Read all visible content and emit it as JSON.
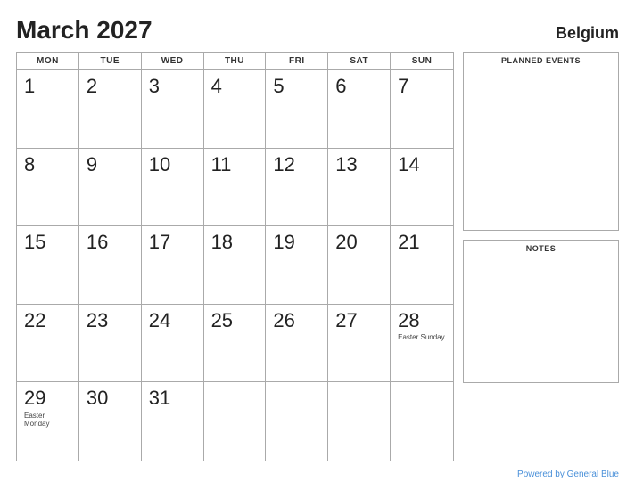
{
  "header": {
    "month_year": "March 2027",
    "country": "Belgium"
  },
  "days_of_week": [
    "MON",
    "TUE",
    "WED",
    "THU",
    "FRI",
    "SAT",
    "SUN"
  ],
  "weeks": [
    [
      {
        "num": "1",
        "event": ""
      },
      {
        "num": "2",
        "event": ""
      },
      {
        "num": "3",
        "event": ""
      },
      {
        "num": "4",
        "event": ""
      },
      {
        "num": "5",
        "event": ""
      },
      {
        "num": "6",
        "event": ""
      },
      {
        "num": "7",
        "event": ""
      }
    ],
    [
      {
        "num": "8",
        "event": ""
      },
      {
        "num": "9",
        "event": ""
      },
      {
        "num": "10",
        "event": ""
      },
      {
        "num": "11",
        "event": ""
      },
      {
        "num": "12",
        "event": ""
      },
      {
        "num": "13",
        "event": ""
      },
      {
        "num": "14",
        "event": ""
      }
    ],
    [
      {
        "num": "15",
        "event": ""
      },
      {
        "num": "16",
        "event": ""
      },
      {
        "num": "17",
        "event": ""
      },
      {
        "num": "18",
        "event": ""
      },
      {
        "num": "19",
        "event": ""
      },
      {
        "num": "20",
        "event": ""
      },
      {
        "num": "21",
        "event": ""
      }
    ],
    [
      {
        "num": "22",
        "event": ""
      },
      {
        "num": "23",
        "event": ""
      },
      {
        "num": "24",
        "event": ""
      },
      {
        "num": "25",
        "event": ""
      },
      {
        "num": "26",
        "event": ""
      },
      {
        "num": "27",
        "event": ""
      },
      {
        "num": "28",
        "event": "Easter Sunday"
      }
    ],
    [
      {
        "num": "29",
        "event": "Easter Monday"
      },
      {
        "num": "30",
        "event": ""
      },
      {
        "num": "31",
        "event": ""
      },
      {
        "num": "",
        "event": ""
      },
      {
        "num": "",
        "event": ""
      },
      {
        "num": "",
        "event": ""
      },
      {
        "num": "",
        "event": ""
      }
    ]
  ],
  "sidebar": {
    "planned_events_label": "PLANNED EVENTS",
    "notes_label": "NOTES"
  },
  "footer": {
    "link_text": "Powered by General Blue"
  }
}
